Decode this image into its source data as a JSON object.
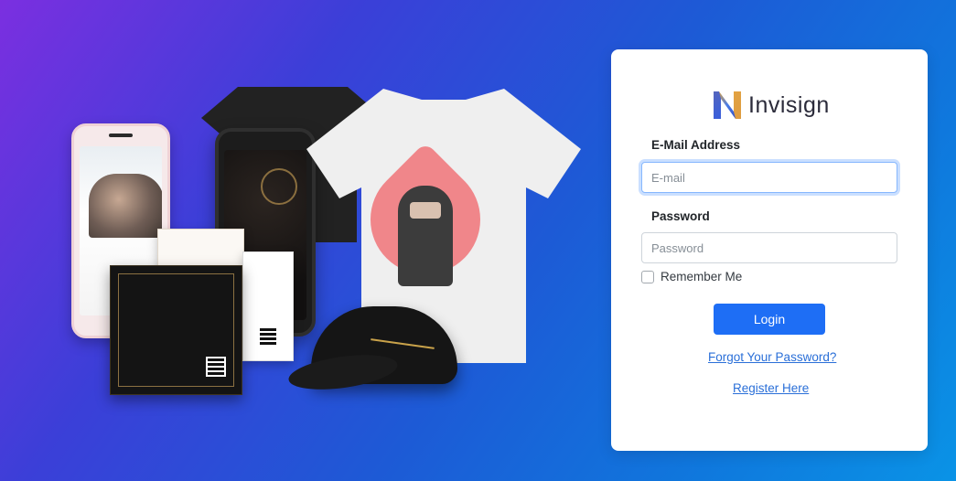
{
  "brand": {
    "name": "Invisign",
    "logo_icon": "invisign-logo-icon"
  },
  "login_form": {
    "email_label": "E-Mail Address",
    "email_placeholder": "E-mail",
    "email_value": "",
    "password_label": "Password",
    "password_placeholder": "Password",
    "password_value": "",
    "remember_label": "Remember Me",
    "remember_checked": false,
    "login_button": "Login",
    "forgot_link": "Forgot Your Password?",
    "register_link": "Register Here"
  },
  "colors": {
    "background_start": "#7b2fe0",
    "background_end": "#0a93e6",
    "primary_button": "#1e6ef5",
    "link": "#2a6fd8",
    "focus_ring": "#86b7fe"
  },
  "hero": {
    "items": [
      "phone-invitation-icon",
      "tshirt-black-icon",
      "tshirt-white-icon",
      "wedding-card-icon",
      "cap-icon"
    ]
  }
}
